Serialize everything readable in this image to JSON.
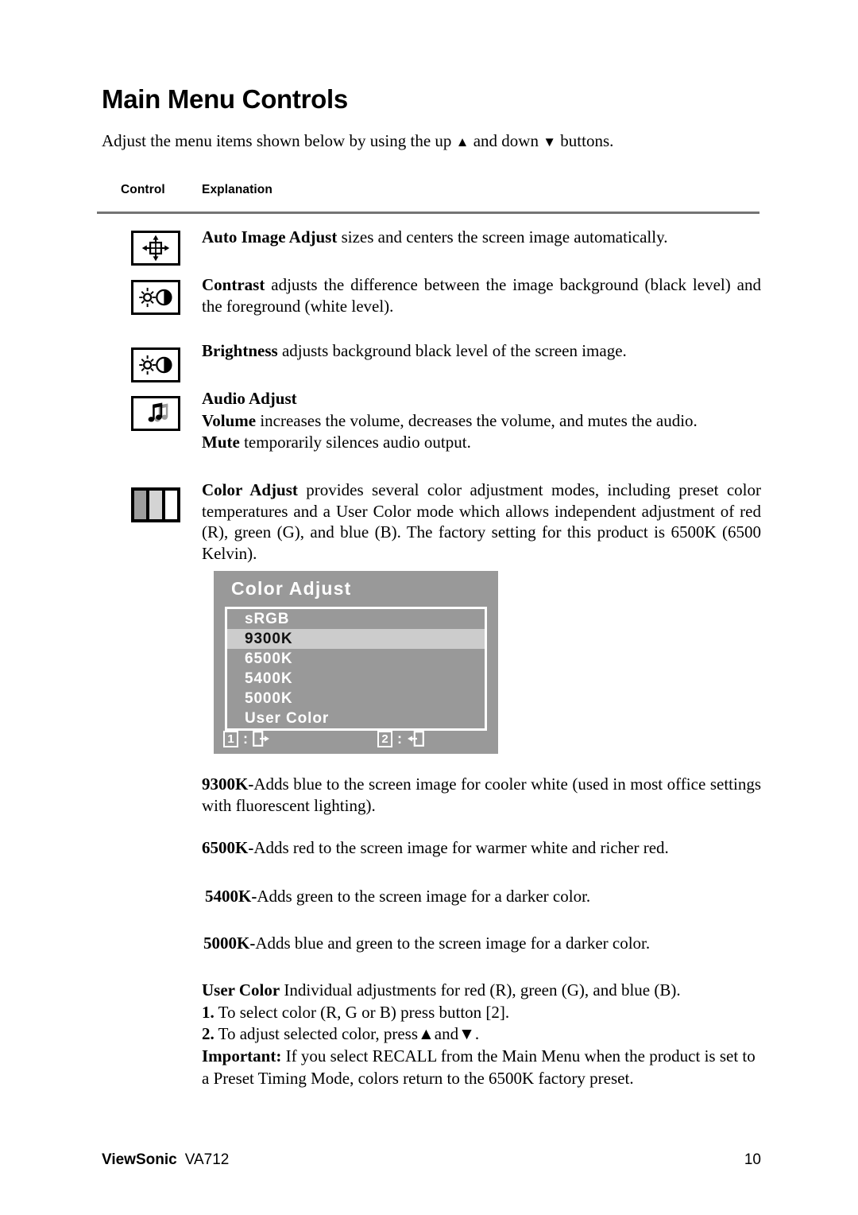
{
  "document": {
    "title": "Main Menu Controls",
    "intro_before": "Adjust the menu items shown below by using the up ",
    "intro_up_arrow": "▲",
    "intro_middle": " and down ",
    "intro_down_arrow": "▼",
    "intro_after": " buttons."
  },
  "table": {
    "header_control": "Control",
    "header_explanation": "Explanation"
  },
  "controls": [
    {
      "icon": "auto-image-adjust-icon",
      "term": "Auto Image Adjust",
      "text": " sizes and centers the screen image automatically."
    },
    {
      "icon": "contrast-icon",
      "term": "Contrast",
      "text": " adjusts the difference between the image background  (black level) and the foreground (white level)."
    },
    {
      "icon": "brightness-icon",
      "term": "Brightness",
      "text": " adjusts background black level of the screen image."
    },
    {
      "icon": "audio-adjust-icon",
      "term": "Audio Adjust",
      "line_volume_term": "Volume",
      "line_volume_text": " increases the volume, decreases the volume, and mutes the audio.",
      "line_mute_term": "Mute",
      "line_mute_text": " temporarily silences audio output."
    },
    {
      "icon": "color-adjust-icon",
      "term": "Color Adjust",
      "text": " provides several color adjustment modes, including preset color temperatures and a User Color mode which allows independent adjustment of red (R), green (G), and blue (B). The factory setting for this product is 6500K (6500 Kelvin)."
    }
  ],
  "osd": {
    "title": "Color Adjust",
    "items": [
      {
        "label": "sRGB",
        "selected": false
      },
      {
        "label": "9300K",
        "selected": true
      },
      {
        "label": "6500K",
        "selected": false
      },
      {
        "label": "5400K",
        "selected": false
      },
      {
        "label": "5000K",
        "selected": false
      },
      {
        "label": "User Color",
        "selected": false
      }
    ],
    "footer": {
      "key1": "1",
      "key1_separator": ":",
      "key1_icon": "exit-door-right-icon",
      "key2": "2",
      "key2_separator": ":",
      "key2_icon": "enter-door-left-icon"
    },
    "colors": {
      "background": "#999999",
      "highlight": "#cccccc",
      "text": "#ffffff",
      "highlight_text": "#111111"
    }
  },
  "temperatures": [
    {
      "term": "9300K-",
      "text": "Adds blue to the screen image for cooler white (used in most office settings with fluorescent lighting)."
    },
    {
      "term": "6500K-",
      "text": "Adds red to the screen image for warmer white and richer red."
    },
    {
      "term": "5400K-",
      "text": "Adds green to the screen image for a darker color."
    },
    {
      "term": "5000K-",
      "text": "Adds blue and green to the screen image for a darker color."
    }
  ],
  "user_color": {
    "term": "User Color",
    "intro": "  Individual adjustments for red (R), green (G),  and blue (B).",
    "step1_num": "1.",
    "step1_text": " To select color (R, G or B) press button [2].",
    "step2_num": "2.",
    "step2_text_before": " To adjust selected color, press",
    "step2_up_arrow": "▲",
    "step2_mid": "and",
    "step2_down_arrow": "▼",
    "step2_text_after": ".",
    "important_term": "Important:",
    "important_text": " If you select RECALL from the Main Menu when the product is set to a Preset Timing Mode, colors return to the 6500K factory preset."
  },
  "footer": {
    "brand": "ViewSonic",
    "model": "VA712",
    "page_number": "10"
  }
}
